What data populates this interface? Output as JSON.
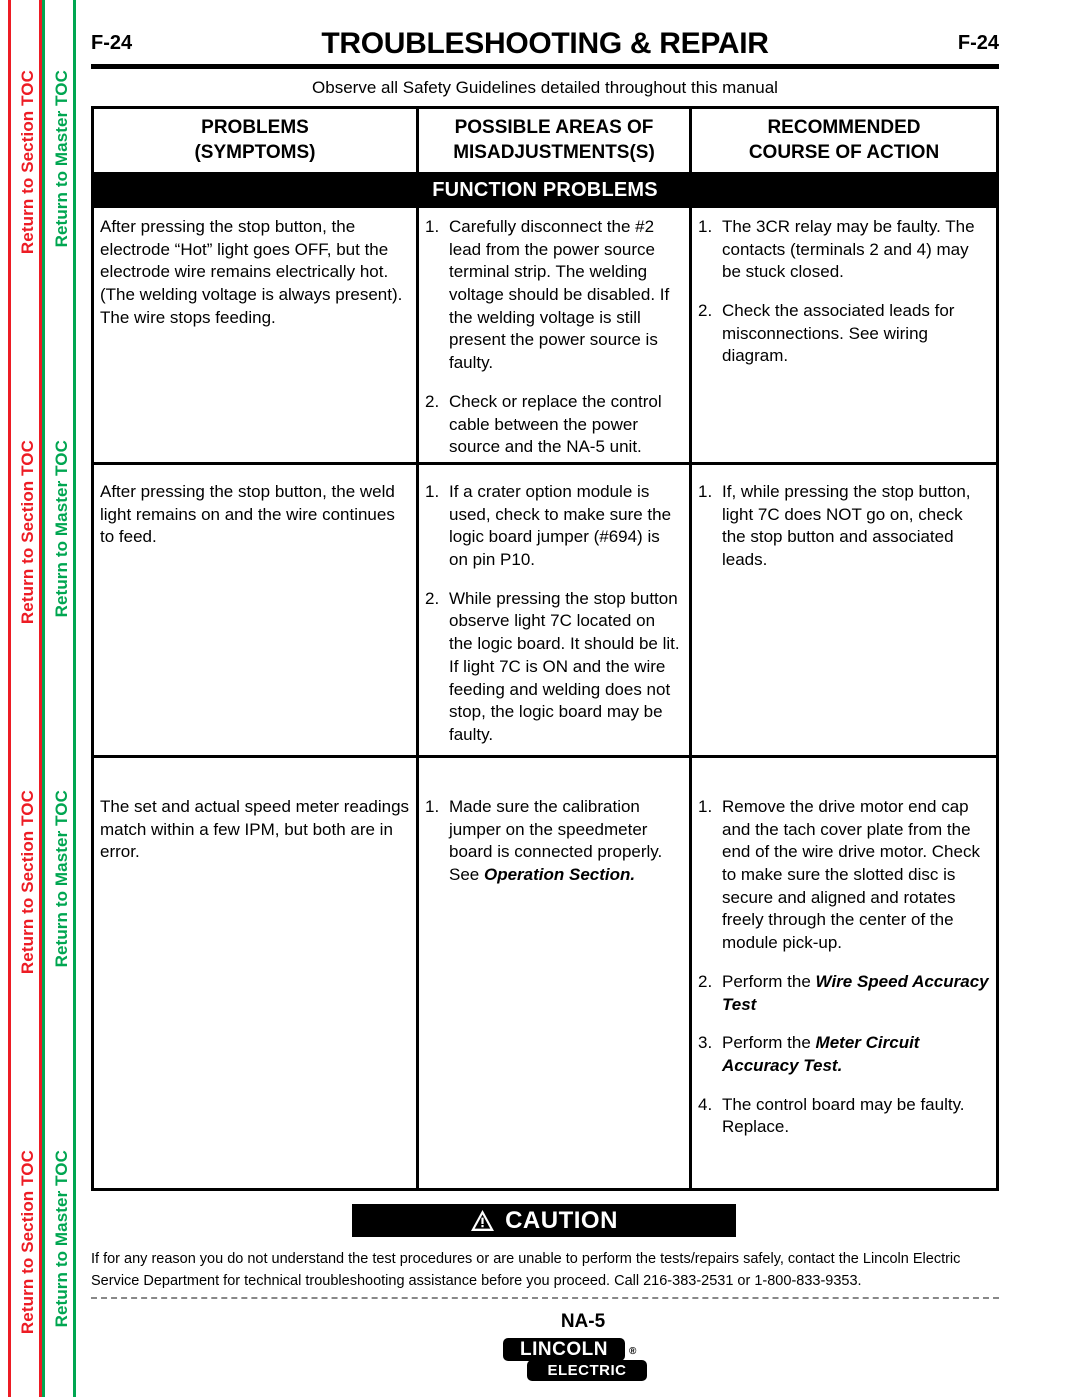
{
  "sidebar": {
    "links": [
      {
        "label": "Return to Section TOC",
        "color": "#ED1C24",
        "kind": "section"
      },
      {
        "label": "Return to Master TOC",
        "color": "#00A651",
        "kind": "master"
      }
    ],
    "repeat_positions": [
      70,
      440,
      780,
      1120
    ]
  },
  "header": {
    "page_left": "F-24",
    "page_right": "F-24",
    "title": "TROUBLESHOOTING & REPAIR",
    "safety_note": "Observe all Safety Guidelines detailed throughout this manual"
  },
  "table": {
    "columns": [
      "PROBLEMS\n(SYMPTOMS)",
      "POSSIBLE AREAS OF\nMISADJUSTMENTS(S)",
      "RECOMMENDED\nCOURSE OF ACTION"
    ],
    "columns_line1": [
      "PROBLEMS",
      "POSSIBLE AREAS OF",
      "RECOMMENDED"
    ],
    "columns_line2": [
      "(SYMPTOMS)",
      "MISADJUSTMENTS(S)",
      "COURSE OF ACTION"
    ],
    "section_band": "FUNCTION PROBLEMS",
    "rows": [
      {
        "symptom": "After pressing the stop button, the electrode “Hot” light goes OFF, but the electrode wire remains electrically hot.  (The welding voltage is always present).  The wire stops feeding.",
        "areas": [
          {
            "num": "1.",
            "text": "Carefully disconnect the #2 lead from the power source terminal strip.  The welding voltage should be disabled.  If the welding voltage is still present the power source is faulty."
          },
          {
            "num": "2.",
            "text": "Check or replace the control cable between the power source and the NA-5 unit."
          }
        ],
        "action": [
          {
            "num": "1.",
            "text": "The 3CR relay may be faulty. The contacts (terminals 2 and 4) may be stuck closed."
          },
          {
            "num": "2.",
            "text": "Check the associated leads for misconnections.  See wiring diagram."
          }
        ]
      },
      {
        "symptom": "After pressing the stop button, the weld light remains on and the wire continues to feed.",
        "areas": [
          {
            "num": "1.",
            "text": "If a crater option module is used, check to make sure the logic board jumper (#694) is on pin P10."
          },
          {
            "num": "2.",
            "text": "While pressing the stop button observe light 7C located on the logic board.  It should be lit.  If light 7C is ON and the wire feeding and welding does not stop, the logic board may be faulty."
          }
        ],
        "action": [
          {
            "num": "1.",
            "text": "If, while pressing the stop button, light 7C does NOT go on,  check the stop button and associated leads."
          }
        ]
      },
      {
        "symptom": "The set and actual speed meter readings match within a few IPM, but both are in error.",
        "areas": [
          {
            "num": "1.",
            "text": "Made sure the calibration jumper on the speedmeter board is connected properly.  See ",
            "emphasis": "Operation Section.",
            "emphasis_position": "after"
          }
        ],
        "action": [
          {
            "num": "1.",
            "text": "Remove the drive motor end cap and the tach cover plate from the end of the wire drive motor. Check to make sure the slotted disc is secure and aligned and rotates freely through the center of the module pick-up."
          },
          {
            "num": "2.",
            "text": "Perform the ",
            "emphasis": "Wire Speed Accuracy Test",
            "emphasis_position": "after"
          },
          {
            "num": "3.",
            "text": "Perform the ",
            "emphasis": "Meter Circuit Accuracy Test.",
            "emphasis_position": "after"
          },
          {
            "num": "4.",
            "text": "The control board may be faulty. Replace."
          }
        ]
      }
    ]
  },
  "caution": {
    "icon": "warning-triangle-icon",
    "label": "CAUTION",
    "body": "If for any reason you do not understand the test procedures or are unable to perform the tests/repairs safely, contact the Lincoln Electric Service Department for technical troubleshooting assistance before you proceed. Call 216-383-2531 or 1-800-833-9353."
  },
  "footer": {
    "model": "NA-5",
    "logo_line1": "LINCOLN",
    "logo_line2": "ELECTRIC",
    "registered_mark": "®"
  }
}
